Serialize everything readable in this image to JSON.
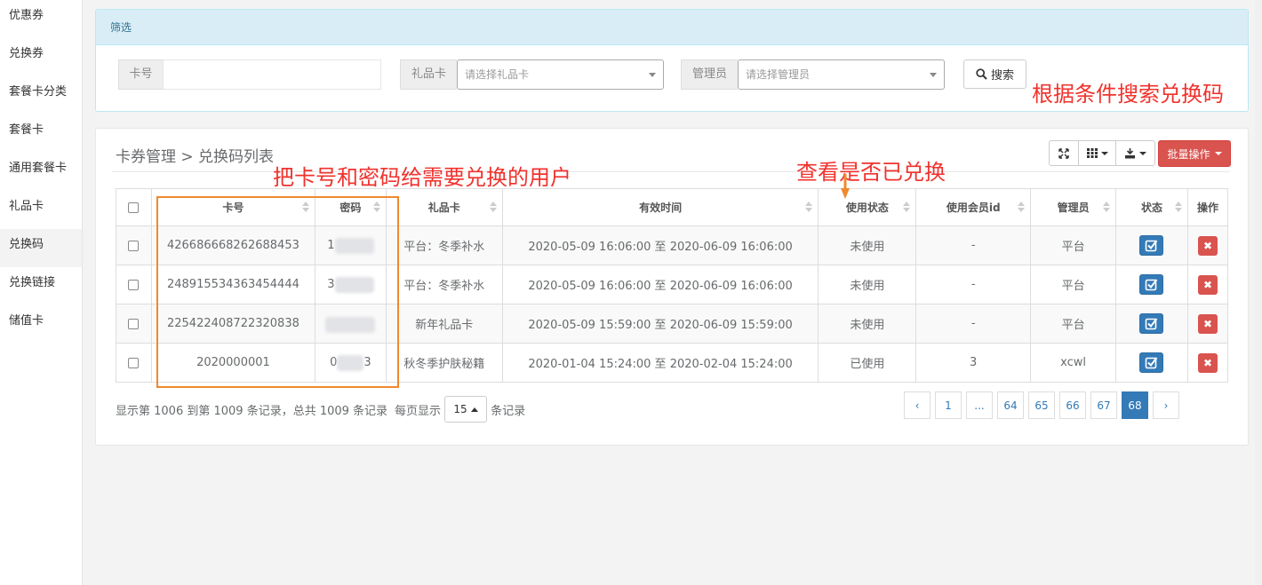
{
  "sidebar": {
    "items": [
      {
        "label": "优惠券"
      },
      {
        "label": "兑换券"
      },
      {
        "label": "套餐卡分类"
      },
      {
        "label": "套餐卡"
      },
      {
        "label": "通用套餐卡"
      },
      {
        "label": "礼品卡"
      },
      {
        "label": "兑换码"
      },
      {
        "label": "兑换链接"
      },
      {
        "label": "储值卡"
      }
    ],
    "active_index": 6
  },
  "filter": {
    "title": "筛选",
    "card_no_label": "卡号",
    "card_no_value": "",
    "gift_card_label": "礼品卡",
    "gift_card_placeholder": "请选择礼品卡",
    "admin_label": "管理员",
    "admin_placeholder": "请选择管理员",
    "search_label": "搜索"
  },
  "annotations": {
    "search_note": "根据条件搜索兑换码",
    "give_note": "把卡号和密码给需要兑换的用户",
    "status_note": "查看是否已兑换"
  },
  "panel": {
    "breadcrumb": "卡券管理 > 兑换码列表",
    "batch_label": "批量操作"
  },
  "table": {
    "headers": [
      "卡号",
      "密码",
      "礼品卡",
      "有效时间",
      "使用状态",
      "使用会员id",
      "管理员",
      "状态",
      "操作"
    ],
    "rows": [
      {
        "card_no": "426686668262688453",
        "password": "1",
        "gift_card": "平台：冬季补水",
        "valid_time": "2020-05-09 16:06:00 至 2020-06-09 16:06:00",
        "use_status": "未使用",
        "member_id": "-",
        "admin": "平台"
      },
      {
        "card_no": "248915534363454444",
        "password": "3",
        "gift_card": "平台：冬季补水",
        "valid_time": "2020-05-09 16:06:00 至 2020-06-09 16:06:00",
        "use_status": "未使用",
        "member_id": "-",
        "admin": "平台"
      },
      {
        "card_no": "225422408722320838",
        "password": "",
        "gift_card": "新年礼品卡",
        "valid_time": "2020-05-09 15:59:00 至 2020-06-09 15:59:00",
        "use_status": "未使用",
        "member_id": "-",
        "admin": "平台"
      },
      {
        "card_no": "2020000001",
        "password": "0",
        "password_tail": "3",
        "gift_card": "秋冬季护肤秘籍",
        "valid_time": "2020-01-04 15:24:00 至 2020-02-04 15:24:00",
        "use_status": "已使用",
        "member_id": "3",
        "admin": "xcwl"
      }
    ]
  },
  "footer": {
    "summary": "显示第 1006 到第 1009 条记录，总共 1009 条记录",
    "per_page_prefix": "每页显示",
    "per_page_value": "15",
    "per_page_suffix": "条记录"
  },
  "pagination": {
    "prev": "‹",
    "next": "›",
    "pages": [
      "1",
      "...",
      "64",
      "65",
      "66",
      "67",
      "68"
    ],
    "active": "68"
  },
  "colors": {
    "accent": "#337ab7",
    "danger": "#d9534f",
    "annotation": "#f0322d",
    "highlight": "#f0892d"
  }
}
